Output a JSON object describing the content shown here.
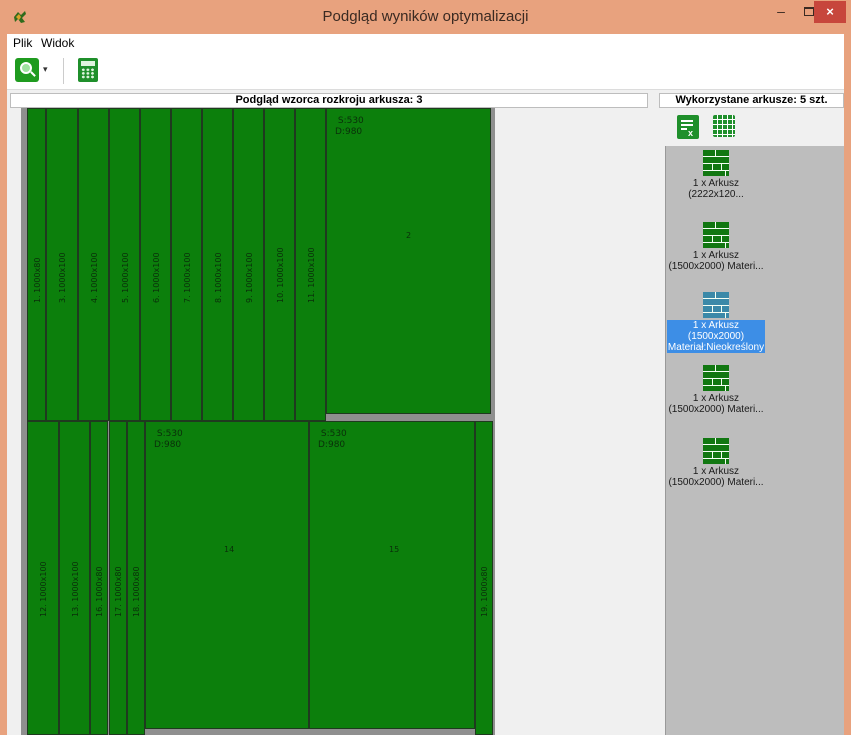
{
  "window": {
    "title": "Podgląd wyników optymalizacji",
    "min_label": "–",
    "close_label": "×"
  },
  "menu": {
    "items": [
      "Plik",
      "Widok"
    ]
  },
  "toolbar": {
    "zoom_icon": "zoom-icon",
    "calc_icon": "calculator-icon",
    "dropdown_glyph": "▾"
  },
  "preview": {
    "header": "Podgląd wzorca rozkroju arkusza: 3",
    "pieces_top": [
      {
        "id": "1.",
        "dim": "1000x80"
      },
      {
        "id": "3.",
        "dim": "1000x100"
      },
      {
        "id": "4.",
        "dim": "1000x100"
      },
      {
        "id": "5.",
        "dim": "1000x100"
      },
      {
        "id": "6.",
        "dim": "1000x100"
      },
      {
        "id": "7.",
        "dim": "1000x100"
      },
      {
        "id": "8.",
        "dim": "1000x100"
      },
      {
        "id": "9.",
        "dim": "1000x100"
      },
      {
        "id": "10.",
        "dim": "1000x100"
      },
      {
        "id": "11.",
        "dim": "1000x100"
      }
    ],
    "pieces_bottom": [
      {
        "id": "12.",
        "dim": "1000x100"
      },
      {
        "id": "13.",
        "dim": "1000x100"
      },
      {
        "id": "16.",
        "dim": "1000x80"
      },
      {
        "id": "17.",
        "dim": "1000x80"
      },
      {
        "id": "18.",
        "dim": "1000x80"
      },
      {
        "id": "19.",
        "dim": "1000x80"
      }
    ],
    "big_pieces": [
      {
        "num": "2",
        "s": "S:530",
        "d": "D:980"
      },
      {
        "num": "14",
        "s": "S:530",
        "d": "D:980"
      },
      {
        "num": "15",
        "s": "S:530",
        "d": "D:980"
      }
    ]
  },
  "sheets_panel": {
    "header": "Wykorzystane arkusze: 5 szt.",
    "items": [
      {
        "lines": [
          "1 x Arkusz",
          "(2222x120..."
        ],
        "selected": false
      },
      {
        "lines": [
          "1 x Arkusz",
          "(1500x2000) Materi..."
        ],
        "selected": false
      },
      {
        "lines": [
          "1 x Arkusz",
          "(1500x2000)",
          "Materiał:Nieokreślony"
        ],
        "selected": true
      },
      {
        "lines": [
          "1 x Arkusz",
          "(1500x2000) Materi..."
        ],
        "selected": false
      },
      {
        "lines": [
          "1 x Arkusz",
          "(1500x2000) Materi..."
        ],
        "selected": false
      }
    ]
  },
  "colors": {
    "piece": "#0c7f0c",
    "selection": "#3d8ee6",
    "titlebar": "#e8a27e",
    "waste": "#8f8f8f"
  }
}
